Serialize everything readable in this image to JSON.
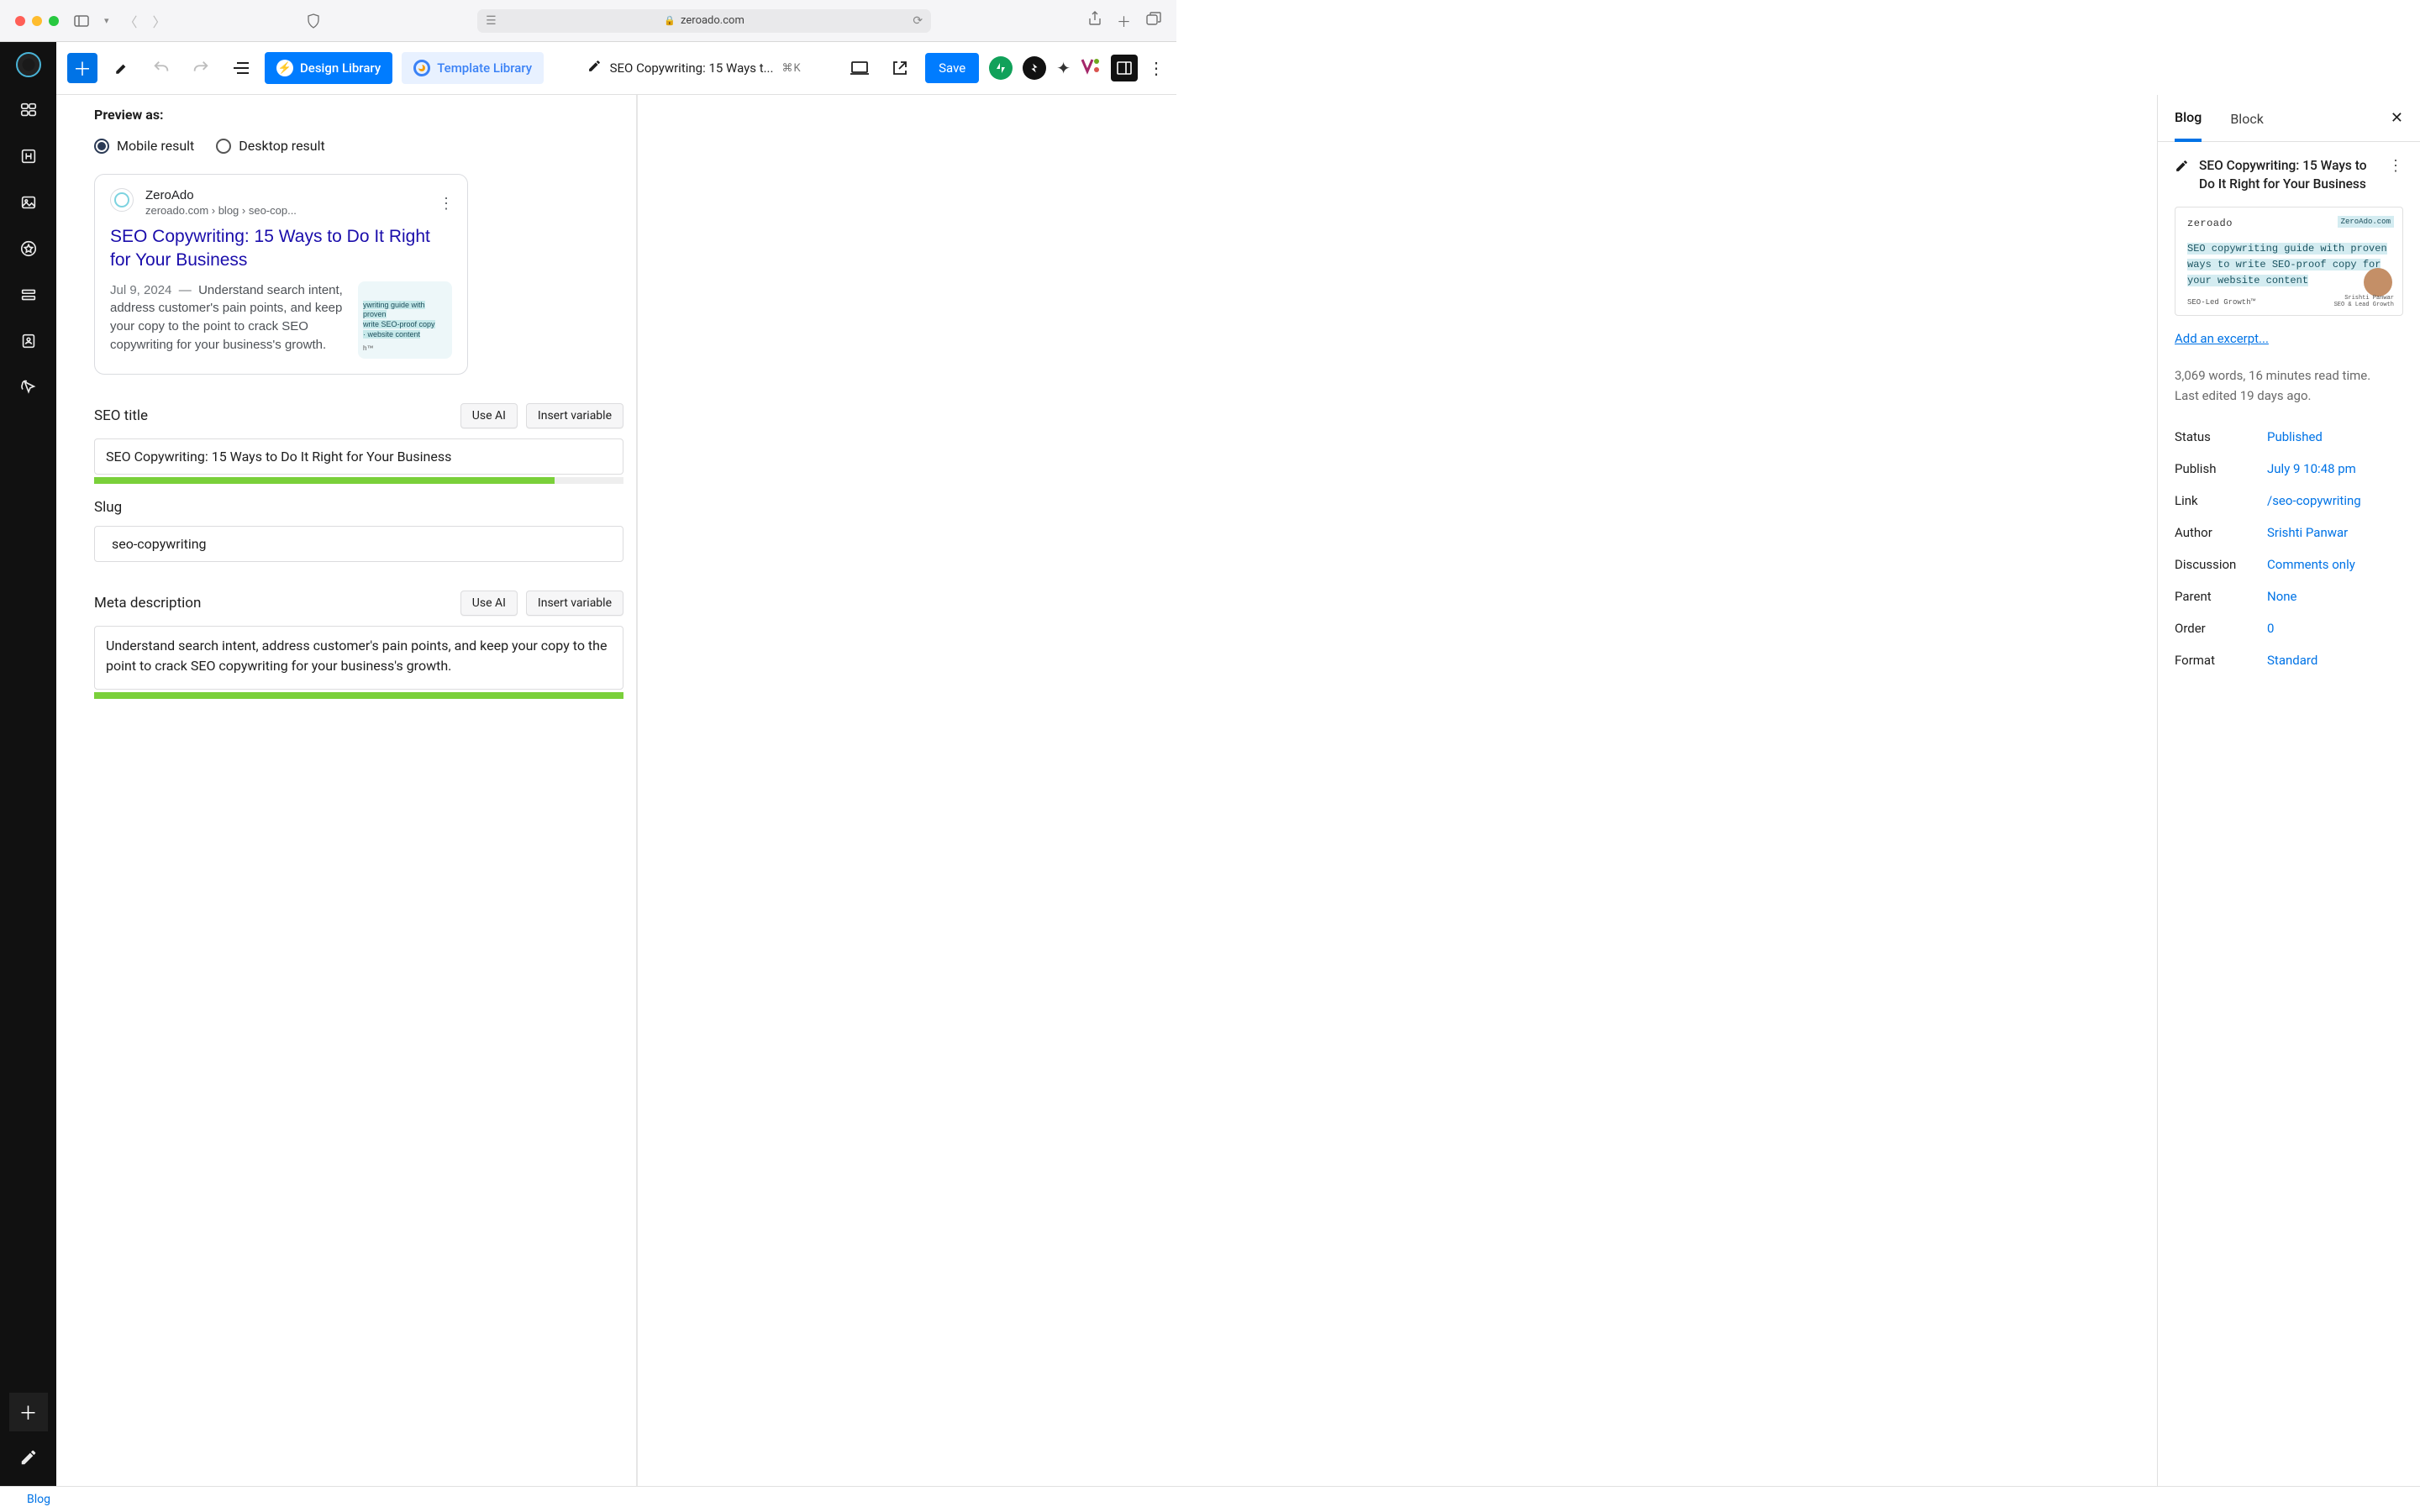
{
  "browser": {
    "domain": "zeroado.com"
  },
  "toolbar": {
    "design_library": "Design Library",
    "template_library": "Template Library",
    "doc_title": "SEO Copywriting: 15 Ways t...",
    "shortcut": "⌘K",
    "save": "Save"
  },
  "editor": {
    "preview_as": "Preview as:",
    "mobile_result": "Mobile result",
    "desktop_result": "Desktop result",
    "serp": {
      "site_name": "ZeroAdo",
      "url_breadcrumb": "zeroado.com › blog › seo-cop...",
      "title": "SEO Copywriting: 15 Ways to Do It Right for Your Business",
      "date": "Jul 9, 2024",
      "desc": "Understand search intent, address customer's pain points, and keep your copy to the point to crack SEO copywriting for your business's growth.",
      "thumb_line1": "ywriting guide with proven",
      "thumb_line2": "write SEO-proof copy",
      "thumb_line3": "· website content",
      "thumb_tm": "h™"
    },
    "seo_title_label": "SEO title",
    "use_ai": "Use AI",
    "insert_variable": "Insert variable",
    "seo_title_value": "SEO Copywriting: 15 Ways to Do It Right for Your Business",
    "seo_title_progress_pct": 87,
    "slug_label": "Slug",
    "slug_value": "seo-copywriting",
    "meta_desc_label": "Meta description",
    "meta_desc_value": "Understand search intent, address customer's pain points, and keep your copy to the point to crack SEO copywriting for your business's growth.",
    "meta_desc_progress_pct": 100
  },
  "sidebar": {
    "tab_blog": "Blog",
    "tab_block": "Block",
    "title": "SEO Copywriting: 15 Ways to Do It Right for Your Business",
    "featured": {
      "brand": "zeroado",
      "tag": "ZeroAdo.com",
      "blurb": "SEO copywriting guide with proven ways to write SEO-proof copy for your website content",
      "sig_name": "Srishti Panwar",
      "sig_sub": "SEO & Lead Growth",
      "foot": "SEO-Led Growth™"
    },
    "add_excerpt": "Add an excerpt...",
    "stats": "3,069 words, 16 minutes read time.",
    "last_edited": "Last edited 19 days ago.",
    "rows": {
      "status_k": "Status",
      "status_v": "Published",
      "publish_k": "Publish",
      "publish_v": "July 9 10:48 pm",
      "link_k": "Link",
      "link_v": "/seo-copywriting",
      "author_k": "Author",
      "author_v": "Srishti Panwar",
      "discussion_k": "Discussion",
      "discussion_v": "Comments only",
      "parent_k": "Parent",
      "parent_v": "None",
      "order_k": "Order",
      "order_v": "0",
      "format_k": "Format",
      "format_v": "Standard"
    }
  },
  "footer": {
    "breadcrumb": "Blog"
  }
}
